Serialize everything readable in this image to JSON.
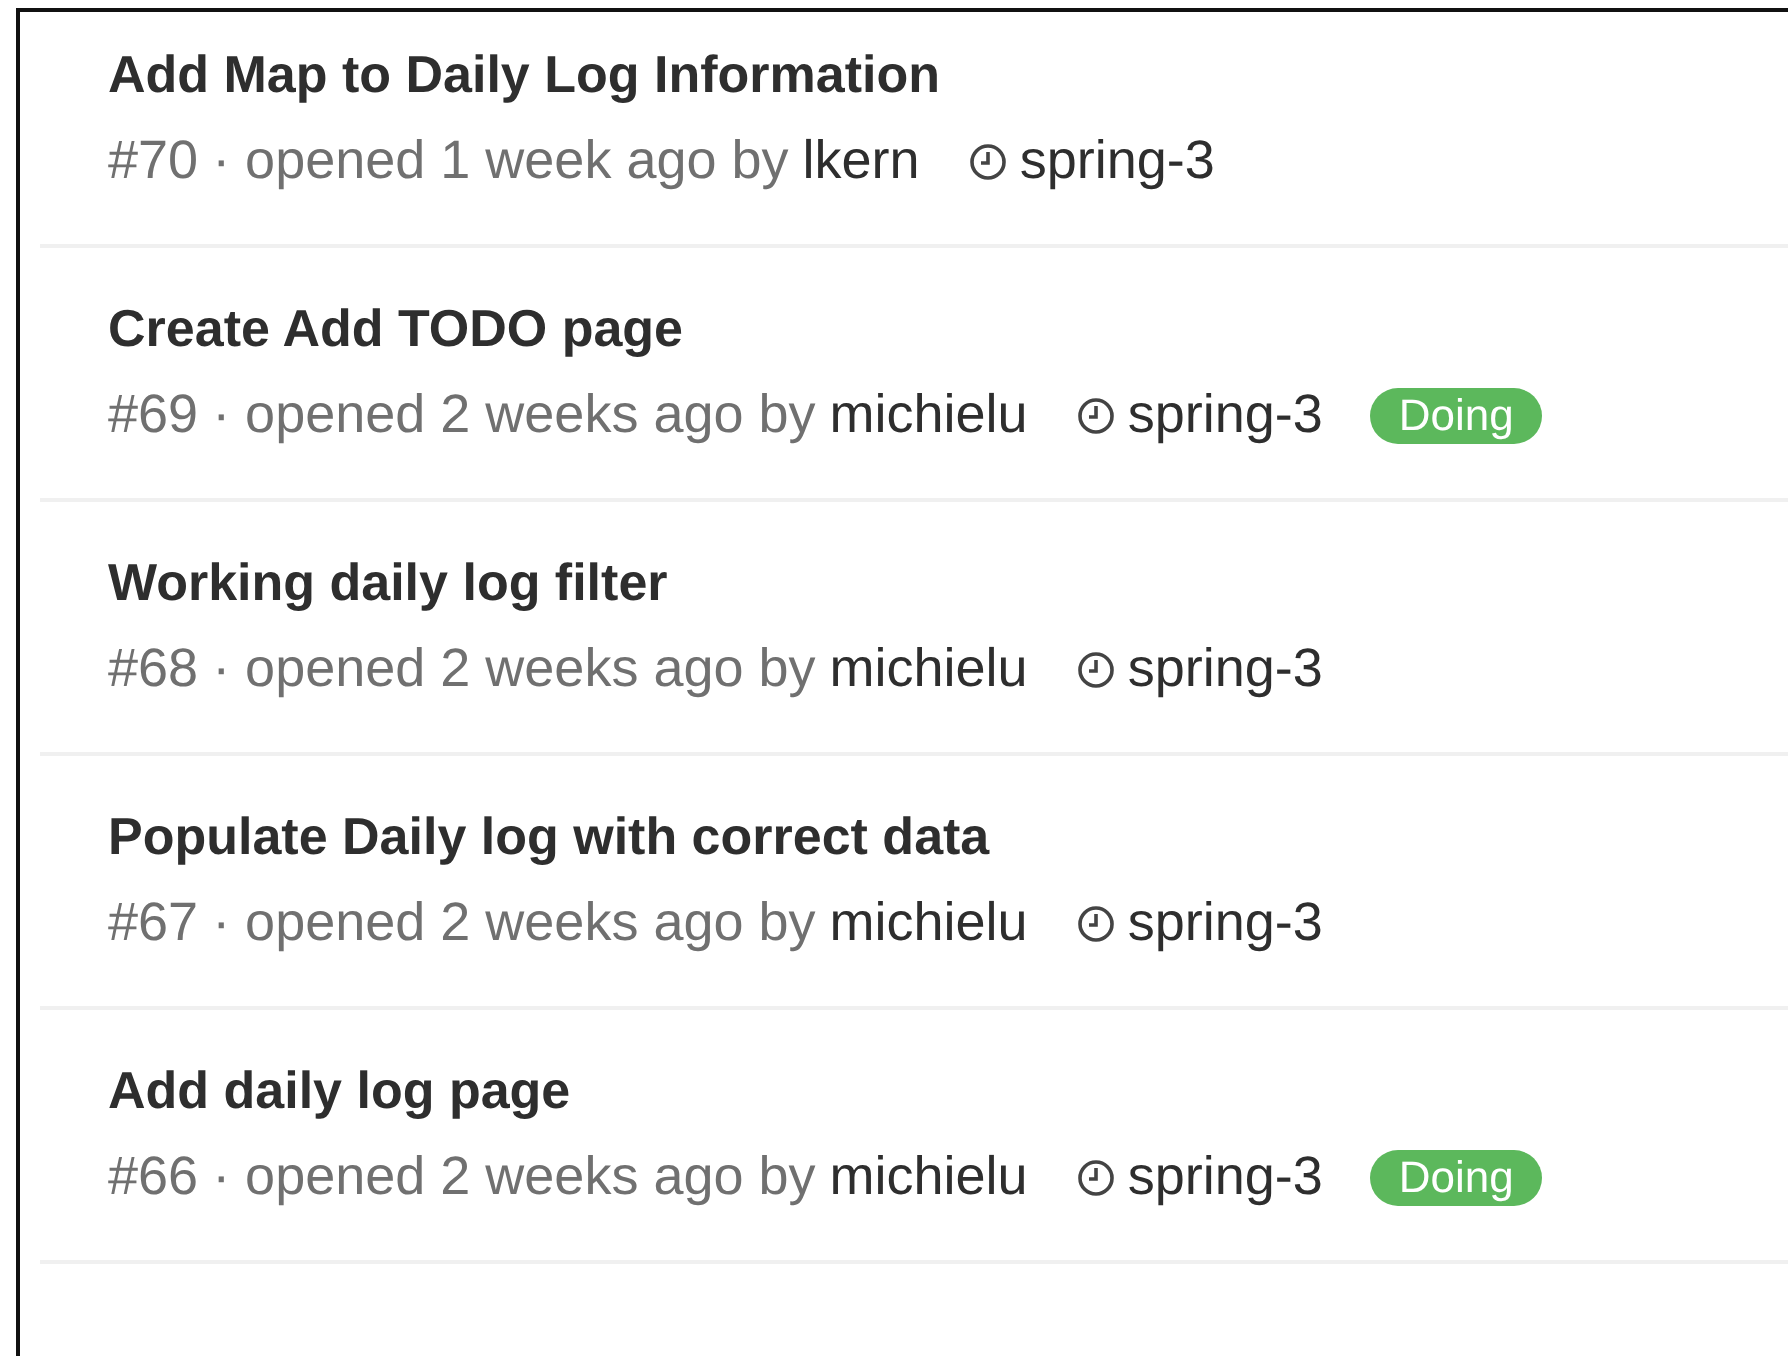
{
  "issues": [
    {
      "title": "Add Map to Daily Log Information",
      "number": "#70",
      "opened": "· opened 1 week ago by",
      "author": "lkern",
      "milestone": "spring-3"
    },
    {
      "title": "Create Add TODO page",
      "number": "#69",
      "opened": "· opened 2 weeks ago by",
      "author": "michielu",
      "milestone": "spring-3",
      "labels": [
        {
          "text": "Doing",
          "color": "#5cb85c"
        }
      ]
    },
    {
      "title": "Working daily log filter",
      "number": "#68",
      "opened": "· opened 2 weeks ago by",
      "author": "michielu",
      "milestone": "spring-3"
    },
    {
      "title": "Populate Daily log with correct data",
      "number": "#67",
      "opened": "· opened 2 weeks ago by",
      "author": "michielu",
      "milestone": "spring-3"
    },
    {
      "title": "Add daily log page",
      "number": "#66",
      "opened": "· opened 2 weeks ago by",
      "author": "michielu",
      "milestone": "spring-3",
      "labels": [
        {
          "text": "Doing",
          "color": "#5cb85c"
        }
      ]
    }
  ]
}
